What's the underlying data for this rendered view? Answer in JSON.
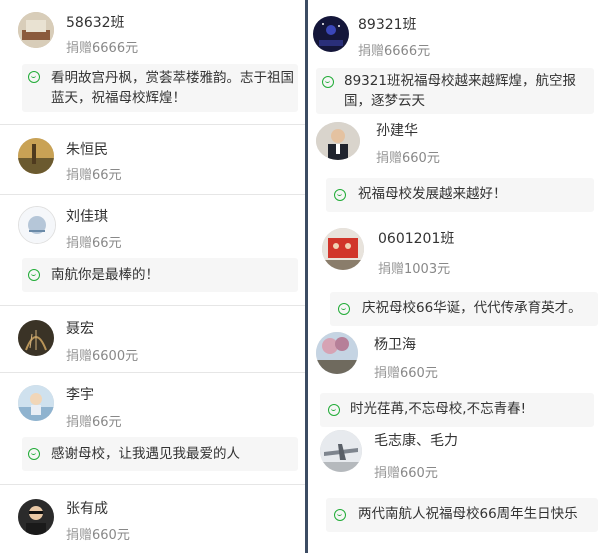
{
  "donation_label": "捐赠",
  "left": [
    {
      "name": "58632班",
      "amount": "6666元",
      "message": "看明故宫丹枫，赏荟萃楼雅韵。志于祖国蓝天，祝福母校辉煌！"
    },
    {
      "name": "朱恒民",
      "amount": "66元",
      "message": ""
    },
    {
      "name": "刘佳琪",
      "amount": "66元",
      "message": "南航你是最棒的！"
    },
    {
      "name": "聂宏",
      "amount": "6600元",
      "message": ""
    },
    {
      "name": "李宇",
      "amount": "66元",
      "message": "感谢母校，让我遇见我最爱的人"
    },
    {
      "name": "张有成",
      "amount": "660元",
      "message": ""
    }
  ],
  "right": [
    {
      "name": "89321班",
      "amount": "6666元",
      "message": "89321班祝福母校越来越辉煌，航空报国，逐梦云天"
    },
    {
      "name": "孙建华",
      "amount": "660元",
      "message": "祝福母校发展越来越好！"
    },
    {
      "name": "0601201班",
      "amount": "1003元",
      "message": "庆祝母校66华诞，代代传承育英才。"
    },
    {
      "name": "杨卫海",
      "amount": "660元",
      "message": "时光荏苒,不忘母校,不忘青春!"
    },
    {
      "name": "毛志康、毛力",
      "amount": "660元",
      "message": "两代南航人祝福母校66周年生日快乐"
    }
  ]
}
